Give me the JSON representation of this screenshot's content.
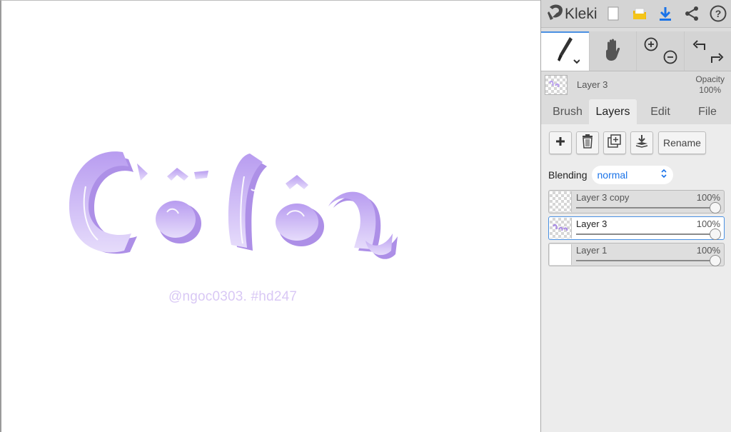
{
  "canvas": {
    "watermark": "@ngoc0303. #hd247"
  },
  "app": {
    "name": "Kleki"
  },
  "topbar": {
    "icons": [
      "kleki-logo-icon",
      "new-file-icon",
      "open-folder-icon",
      "download-icon",
      "share-icon",
      "help-icon"
    ],
    "colors": {
      "download": "#1a73e8",
      "folder": "#f0b400"
    }
  },
  "tools": {
    "active": "brush",
    "icons": [
      "brush-icon",
      "hand-icon",
      "zoom-in-icon",
      "zoom-out-icon",
      "undo-icon",
      "redo-icon"
    ]
  },
  "current_layer": {
    "name": "Layer 3",
    "opacity_label": "Opacity",
    "opacity_value": "100%"
  },
  "tabs": [
    {
      "label": "Brush",
      "active": false
    },
    {
      "label": "Layers",
      "active": true
    },
    {
      "label": "Edit",
      "active": false
    },
    {
      "label": "File",
      "active": false
    }
  ],
  "layer_actions": {
    "rename_label": "Rename",
    "icons": [
      "add-layer-icon",
      "delete-layer-icon",
      "duplicate-layer-icon",
      "merge-down-icon"
    ]
  },
  "blending": {
    "label": "Blending",
    "value": "normal"
  },
  "layers": [
    {
      "name": "Layer 3 copy",
      "opacity": "100%",
      "opacity_fraction": 1.0,
      "selected": false
    },
    {
      "name": "Layer 3",
      "opacity": "100%",
      "opacity_fraction": 1.0,
      "selected": true
    },
    {
      "name": "Layer 1",
      "opacity": "100%",
      "opacity_fraction": 1.0,
      "selected": false
    }
  ],
  "accent_color": "#4a90e2",
  "art_color": "#c7b0ef"
}
